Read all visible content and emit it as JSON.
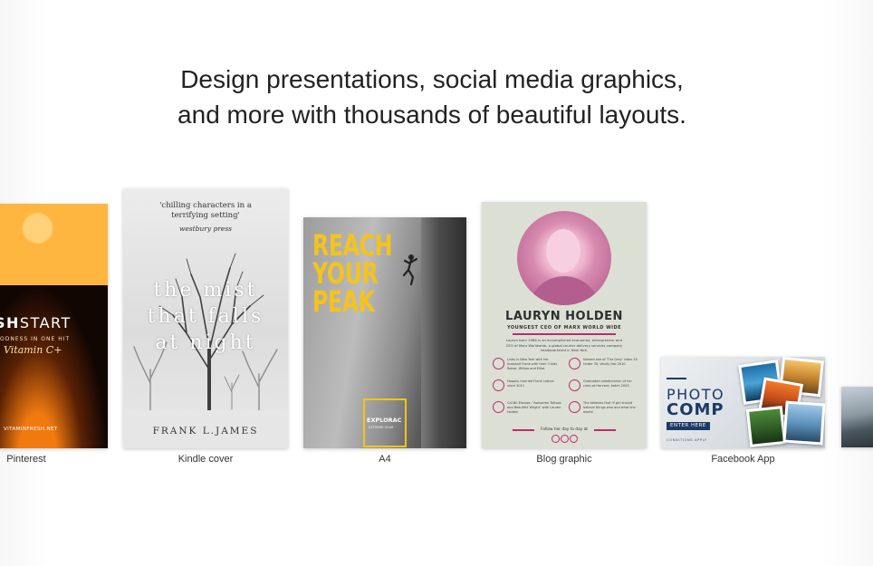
{
  "headline": {
    "line1": "Design presentations, social media graphics,",
    "line2": "and more with thousands of beautiful layouts."
  },
  "templates": [
    {
      "caption": "Pinterest",
      "brand_bold": "SH",
      "brand_light": "START",
      "subtitle": "ODNESS IN ONE HIT",
      "tagline": "Vitamin C+",
      "url": "VITAMINFRESH.NET"
    },
    {
      "caption": "Kindle cover",
      "quote_line1": "'chilling characters in a",
      "quote_line2": "terrifying setting'",
      "press": "westbury press",
      "title_line1": "the mist",
      "title_line2": "that falls",
      "title_line3": "at night",
      "author": "FRANK L.JAMES"
    },
    {
      "caption": "A4",
      "title_line1": "REACH",
      "title_line2": "YOUR",
      "title_line3": "PEAK",
      "box_title": "EXPLORAC",
      "box_sub": "EXTREME GEAR"
    },
    {
      "caption": "Blog graphic",
      "name": "LAURYN HOLDEN",
      "role": "YOUNGEST CEO OF MARX WORLD WIDE",
      "bio": "Lauryn born 1986 is an accomplished economist, entrepreneur and CEO of Marx Worldwide, a global courier delivery services company headquartered in New York.",
      "facts": [
        "Lives in New York with her husband Frank with their 3 kids Reese, Willow and Elliot",
        "Named one of 'The Grey' index 20 Under 30, Vanity Fab 2010",
        "Happily married Frank Lebron since 2011",
        "Graduated valedictorian of her class at Harvard, batch 2003",
        "Cal-Bri Elerose: \"Awesome Tattoos and Beautiful Wright\" with Lauren Holden",
        "The believes that 'If girl should believe things who and what she wants'"
      ],
      "follow": "Follow her day to day at"
    },
    {
      "caption": "Facebook App",
      "word1": "PHOTO",
      "word2": "COMP",
      "button": "ENTER HERE",
      "conditions": "CONDITIONS APPLY"
    }
  ],
  "colors": {
    "accent_yellow": "#f5c31b",
    "accent_magenta": "#b92d6a",
    "accent_navy": "#1c3a66"
  }
}
